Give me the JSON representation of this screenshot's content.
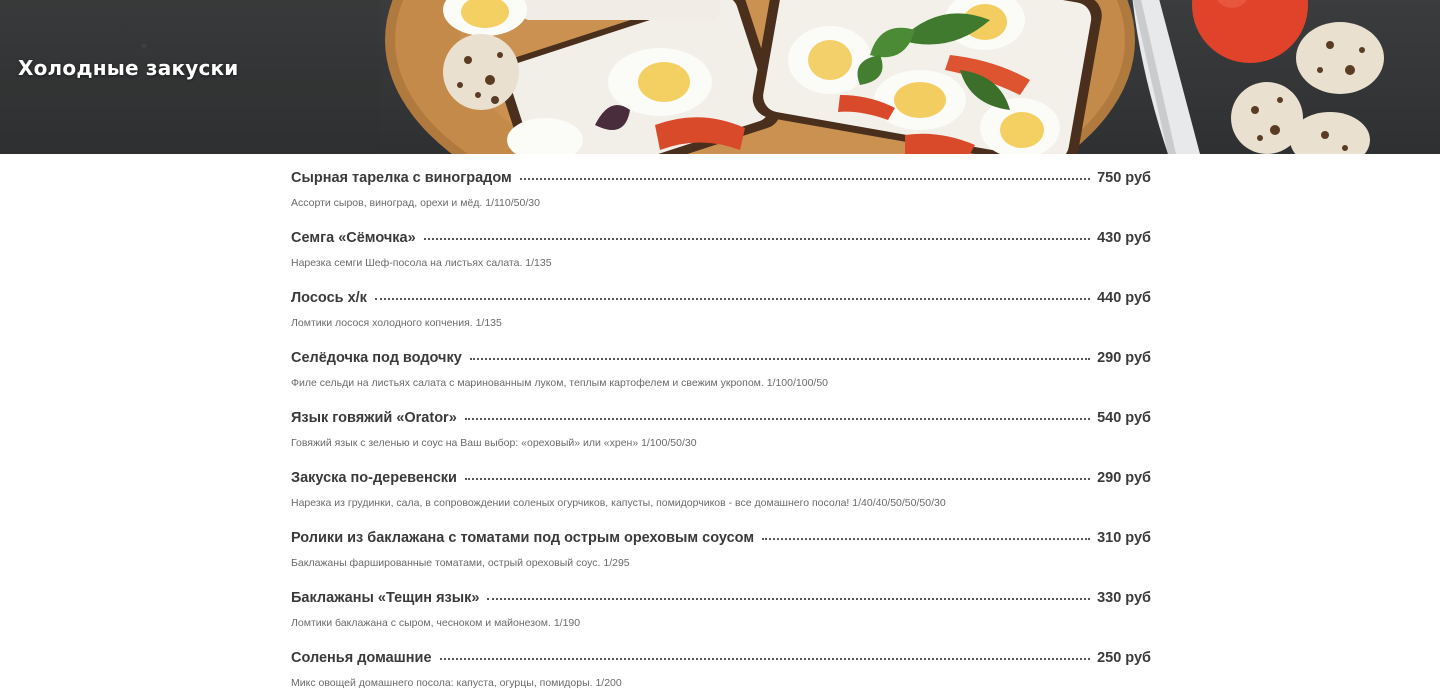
{
  "section": {
    "title": "Холодные закуски"
  },
  "items": [
    {
      "name": "Сырная тарелка с виноградом",
      "price": "750 руб",
      "description": "Ассорти сыров, виноград, орехи и мёд. 1/110/50/30"
    },
    {
      "name": "Семга «Сёмочка»",
      "price": "430 руб",
      "description": "Нарезка семги Шеф-посола на листьях салата. 1/135"
    },
    {
      "name": "Лосось х/к",
      "price": "440 руб",
      "description": "Ломтики лосося холодного копчения. 1/135"
    },
    {
      "name": "Селёдочка под водочку",
      "price": "290 руб",
      "description": "Филе сельди на листьях салата с маринованным луком, теплым картофелем и свежим укропом. 1/100/100/50"
    },
    {
      "name": "Язык говяжий «Orator»",
      "price": "540 руб",
      "description": "Говяжий язык с зеленью и соус на Ваш выбор: «ореховый» или «хрен» 1/100/50/30"
    },
    {
      "name": "Закуска по-деревенски",
      "price": "290 руб",
      "description": "Нарезка из грудинки, сала, в сопровождении соленых огурчиков, капусты, помидорчиков - все домашнего посола! 1/40/40/50/50/50/30"
    },
    {
      "name": "Ролики из баклажана с томатами под острым ореховым соусом",
      "price": "310 руб",
      "description": "Баклажаны фаршированные томатами, острый ореховый соус. 1/295"
    },
    {
      "name": "Баклажаны «Тещин язык»",
      "price": "330 руб",
      "description": "Ломтики баклажана с сыром, чесноком и майонезом. 1/190"
    },
    {
      "name": "Соленья домашние",
      "price": "250 руб",
      "description": "Микс овощей домашнего посола: капуста, огурцы, помидоры. 1/200"
    }
  ]
}
